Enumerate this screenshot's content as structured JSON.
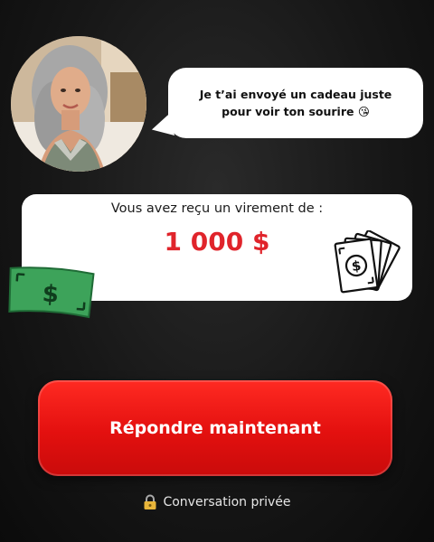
{
  "message": {
    "text": "Je t’ai envoyé un cadeau juste pour voir ton sourire",
    "emoji": "😘"
  },
  "transfer": {
    "label": "Vous avez reçu un virement de :",
    "amount": "1 000 $"
  },
  "cta": {
    "label": "Répondre maintenant"
  },
  "footer": {
    "lock_icon": "lock-icon",
    "text": "Conversation privée"
  },
  "colors": {
    "background": "#171717",
    "amount": "#e0242b",
    "button": "#e3100f",
    "bill_green": "#2e9a4e"
  }
}
